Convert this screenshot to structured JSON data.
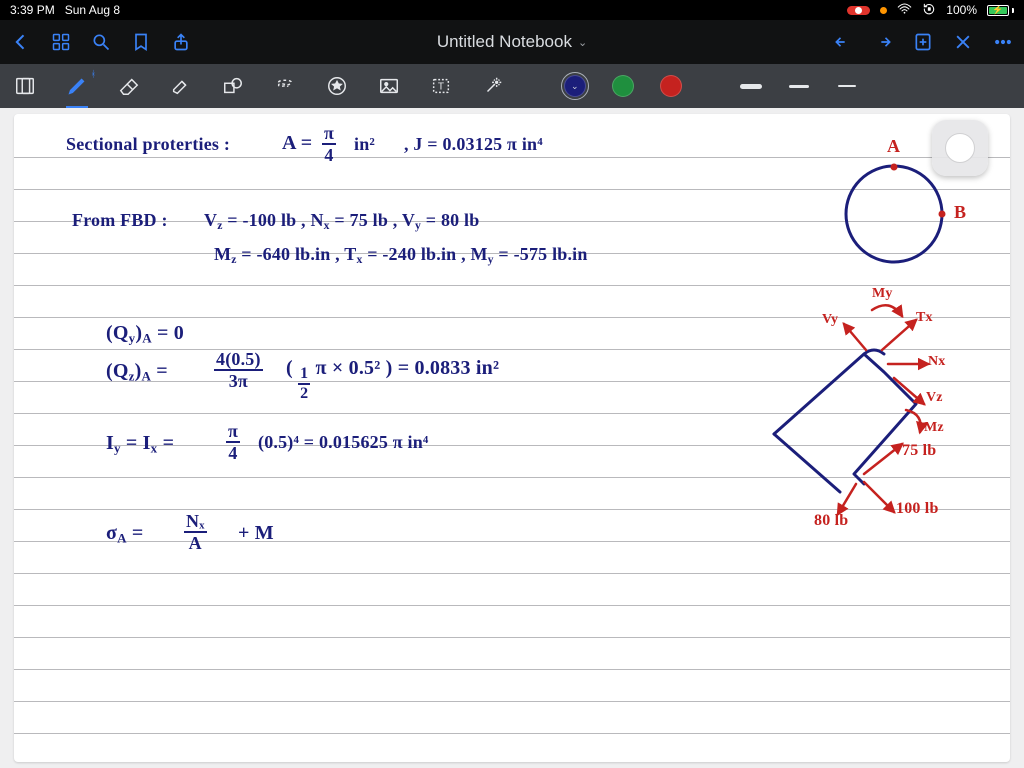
{
  "status": {
    "time": "3:39 PM",
    "date": "Sun Aug 8",
    "battery_pct": "100%"
  },
  "nav": {
    "title": "Untitled Notebook"
  },
  "tools": {
    "colors": {
      "c1": "#1b1e7a",
      "c2": "#1f8f3e",
      "c3": "#c5221f"
    }
  },
  "notes": {
    "l1a": "Sectional proterties :",
    "l1b": "A =",
    "l1c_num": "π",
    "l1c_den": "4",
    "l1d": "in²",
    "l1e": ",  J = 0.03125 π   in⁴",
    "l2a": "From FBD :",
    "l2b": "V",
    "l2b_sub": "z",
    "l2c": " = -100 lb ,  N",
    "l2c_sub": "x",
    "l2d": " = 75  lb ,  V",
    "l2d_sub": "y",
    "l2e": " = 80  lb",
    "l3a": "M",
    "l3a_sub": "z",
    "l3b": " = -640  lb.in ,  T",
    "l3b_sub": "x",
    "l3c": " = -240  lb.in ,  M",
    "l3c_sub": "y",
    "l3d": " = -575 lb.in",
    "l4a": "(Q",
    "l4a_sub": "y",
    "l4b": ")",
    "l4b_sub": "A",
    "l4c": " = 0",
    "l5a": "(Q",
    "l5a_sub": "z",
    "l5b": ")",
    "l5b_sub": "A",
    "l5c": " =",
    "l5_num": "4(0.5)",
    "l5_den": "3π",
    "l5d": "(",
    "l5d_num": "1",
    "l5d_den": "2",
    "l5e": "π × 0.5² ) = 0.0833 in²",
    "l6a": "I",
    "l6a_sub": "y",
    "l6b": " = I",
    "l6b_sub": "x",
    "l6c": " =",
    "l6_num": "π",
    "l6_den": "4",
    "l6d": "(0.5)⁴ = 0.015625 π  in⁴",
    "l7a": "σ",
    "l7a_sub": "A",
    "l7b": " =",
    "l7_num": "Nₓ",
    "l7_den": "A",
    "l7c": " +  M",
    "labA": "A",
    "labB": "B",
    "My": "My",
    "Vy": "Vy",
    "Tx": "Tx",
    "Nx": "Nx",
    "Vz": "Vz",
    "Mz": "Mz",
    "f75": "75 lb",
    "f100": "100 lb",
    "f80": "80 lb"
  }
}
